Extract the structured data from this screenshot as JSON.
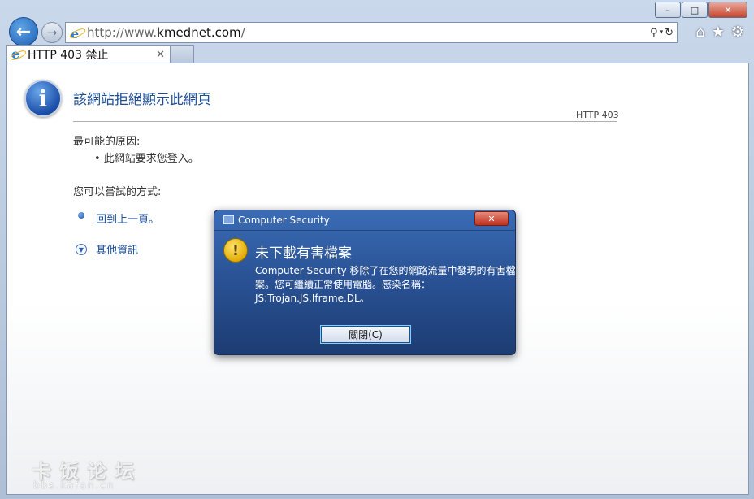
{
  "window": {
    "minimize_glyph": "–",
    "maximize_glyph": "□",
    "close_glyph": "✕"
  },
  "browser": {
    "url_prefix": "http://www.",
    "url_domain": "kmednet.com",
    "url_suffix": "/",
    "tab_title": "HTTP 403 禁止",
    "tab_close_glyph": "✕"
  },
  "page": {
    "title": "該網站拒絕顯示此網頁",
    "http_code": "HTTP 403",
    "cause_heading": "最可能的原因:",
    "cause_item": "•  此網站要求您登入。",
    "try_heading": "您可以嘗試的方式:",
    "back_link": "回到上一頁。",
    "more_info": "其他資訊"
  },
  "watermark": {
    "main": "卡饭论坛",
    "sub": "bbs.kafan.cn"
  },
  "dialog": {
    "title": "Computer Security",
    "heading": "未下載有害檔案",
    "message_lines": [
      "Computer Security 移除了在您的網路流量中發現的有害檔",
      "案。您可繼續正常使用電腦。感染名稱：",
      "JS:Trojan.JS.Iframe.DL。"
    ],
    "button_label": "關閉(C)",
    "close_glyph": "✕"
  }
}
